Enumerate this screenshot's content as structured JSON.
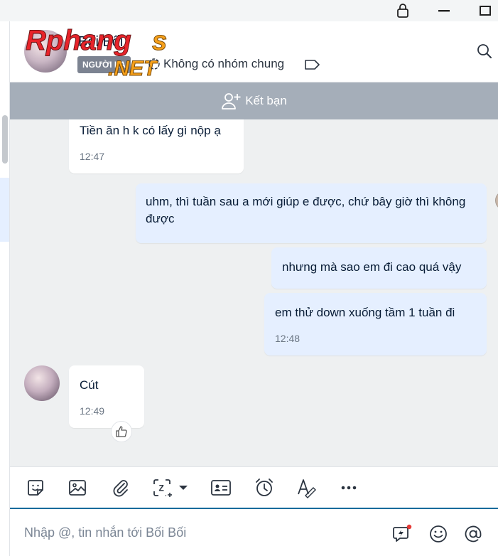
{
  "header": {
    "contact_name": "Bối Bối",
    "stranger_tag": "NGƯỜI LẠ",
    "group_status": "Không có nhóm chung",
    "watermark": "Rphangs .NET"
  },
  "banner": {
    "add_friend_label": "Kết bạn"
  },
  "messages": [
    {
      "text": "Tiền ăn h k có lấy gì nộp ạ",
      "time": "12:47"
    },
    {
      "text": "uhm, thì tuần sau a mới giúp e được, chứ bây giờ thì không được"
    },
    {
      "text": "nhưng mà sao em đi cao quá vậy"
    },
    {
      "text": "em thử down xuống tầm 1 tuần đi",
      "time": "12:48"
    },
    {
      "text": "Cút",
      "time": "12:49"
    }
  ],
  "composer": {
    "placeholder": "Nhập @, tin nhắn tới Bối Bối"
  },
  "colors": {
    "accent": "#0b6b9c",
    "outgoing_bubble": "#e5efff",
    "banner": "#a5aeb9",
    "notify_dot": "#e53935"
  }
}
